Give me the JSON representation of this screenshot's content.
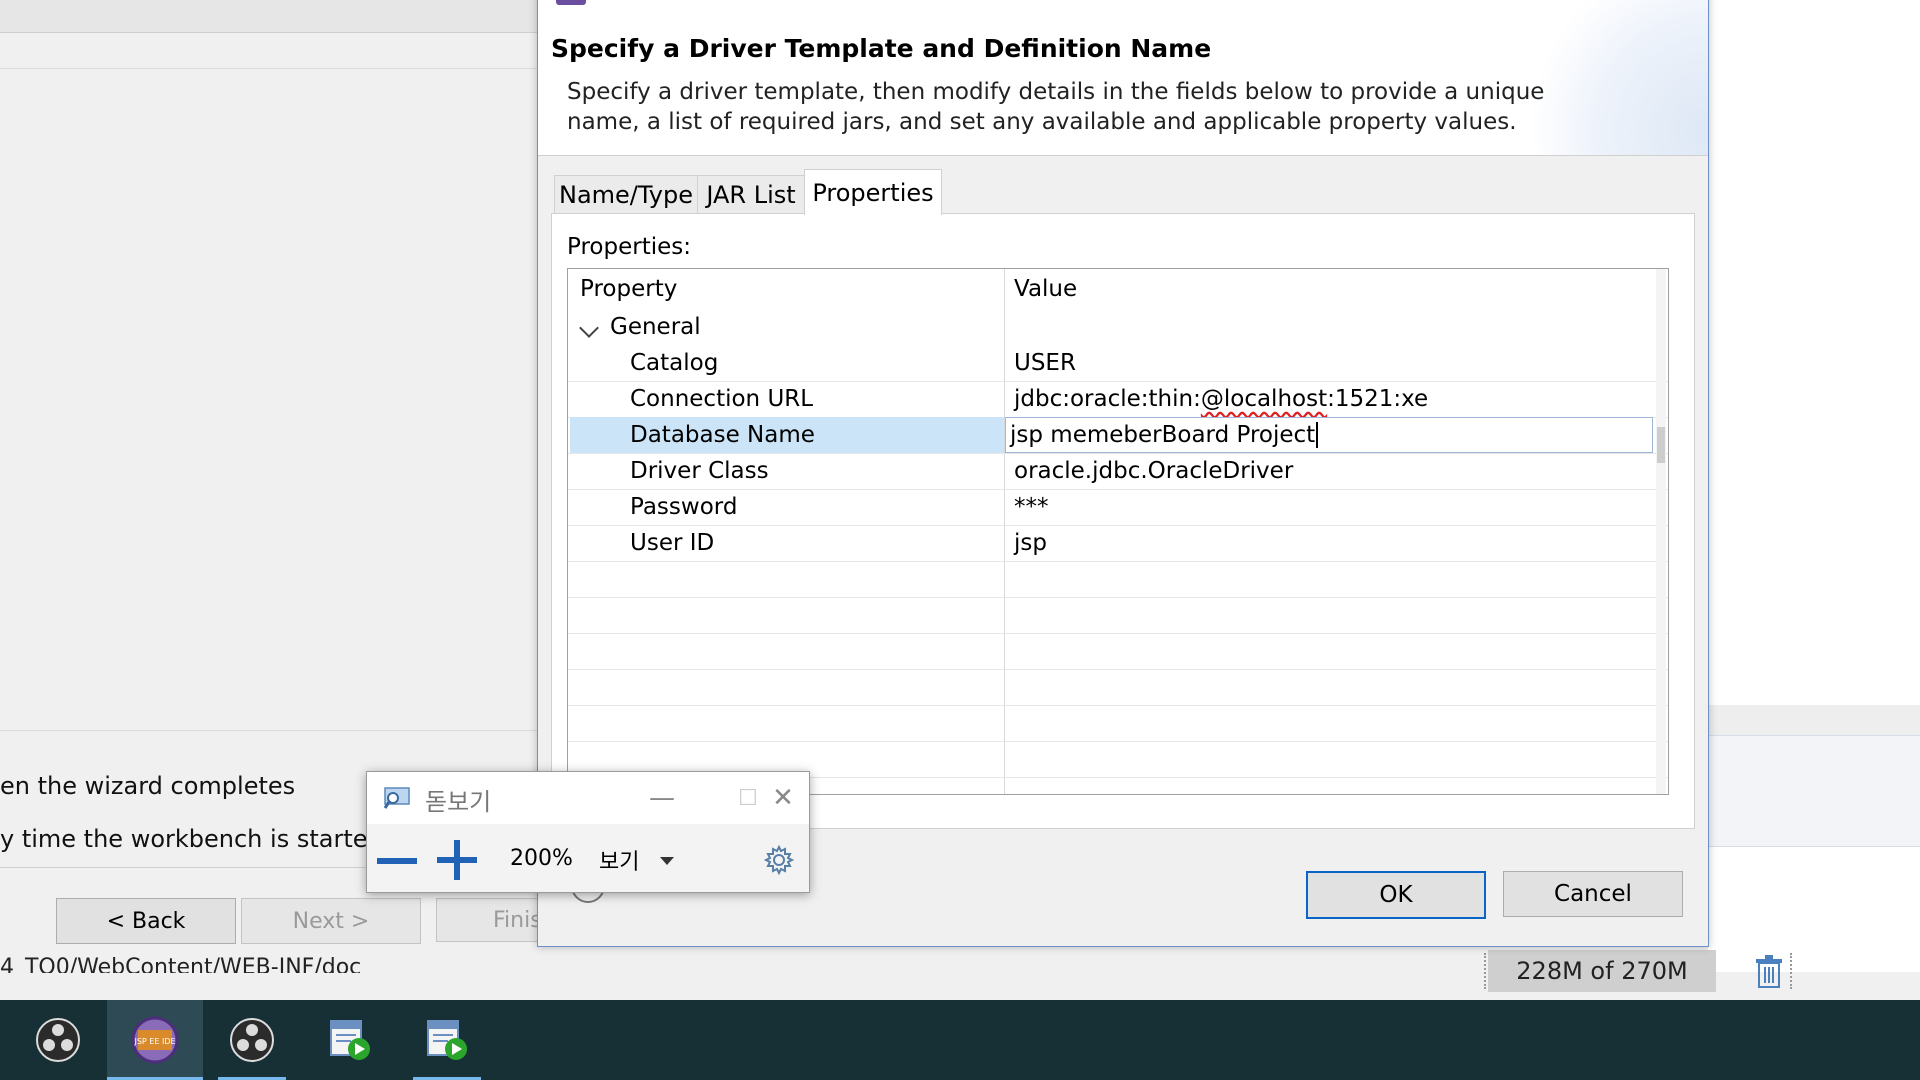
{
  "wizard": {
    "option1": "en the wizard completes",
    "option2": "y time the workbench is started",
    "back_label": "< Back",
    "next_label": "Next >",
    "finish_label": "Finis",
    "status_path": "4_TO0/WebContent/WEB-INF/doc"
  },
  "memory": {
    "text": "228M of 270M"
  },
  "dialog": {
    "title": "Specify a Driver Template and Definition Name",
    "description": "Specify a driver template, then modify details in the fields below to provide a unique name, a list of required jars, and set any available and applicable property values.",
    "tabs": [
      "Name/Type",
      "JAR List",
      "Properties"
    ],
    "active_tab": "Properties",
    "properties_label": "Properties:",
    "columns": [
      "Property",
      "Value"
    ],
    "group": "General",
    "rows": [
      {
        "property": "Catalog",
        "value": "USER"
      },
      {
        "property": "Connection URL",
        "value": "jdbc:oracle:thin:@localhost:1521:xe"
      },
      {
        "property": "Database Name",
        "value": "jsp memeberBoard Project"
      },
      {
        "property": "Driver Class",
        "value": "oracle.jdbc.OracleDriver"
      },
      {
        "property": "Password",
        "value": "***"
      },
      {
        "property": "User ID",
        "value": "jsp"
      }
    ],
    "url_parts": {
      "prefix": "jdbc:oracle:thin:",
      "underlined": "@localhost",
      "suffix": ":1521:xe"
    },
    "help_glyph": "?",
    "ok_label": "OK",
    "cancel_label": "Cancel"
  },
  "magnifier": {
    "title": "돋보기",
    "zoom": "200%",
    "view_label": "보기",
    "minimize_glyph": "—",
    "maximize_glyph": "☐",
    "close_glyph": "✕"
  },
  "taskbar": {
    "items": [
      "obs-icon",
      "jsp-ee-ide-icon",
      "obs-icon",
      "run-app-icon",
      "run-app-icon"
    ],
    "ide_badge": "JSP EE IDE"
  },
  "colors": {
    "accent": "#0a64c8",
    "selection": "#cce4f7",
    "taskbar": "#163036"
  }
}
